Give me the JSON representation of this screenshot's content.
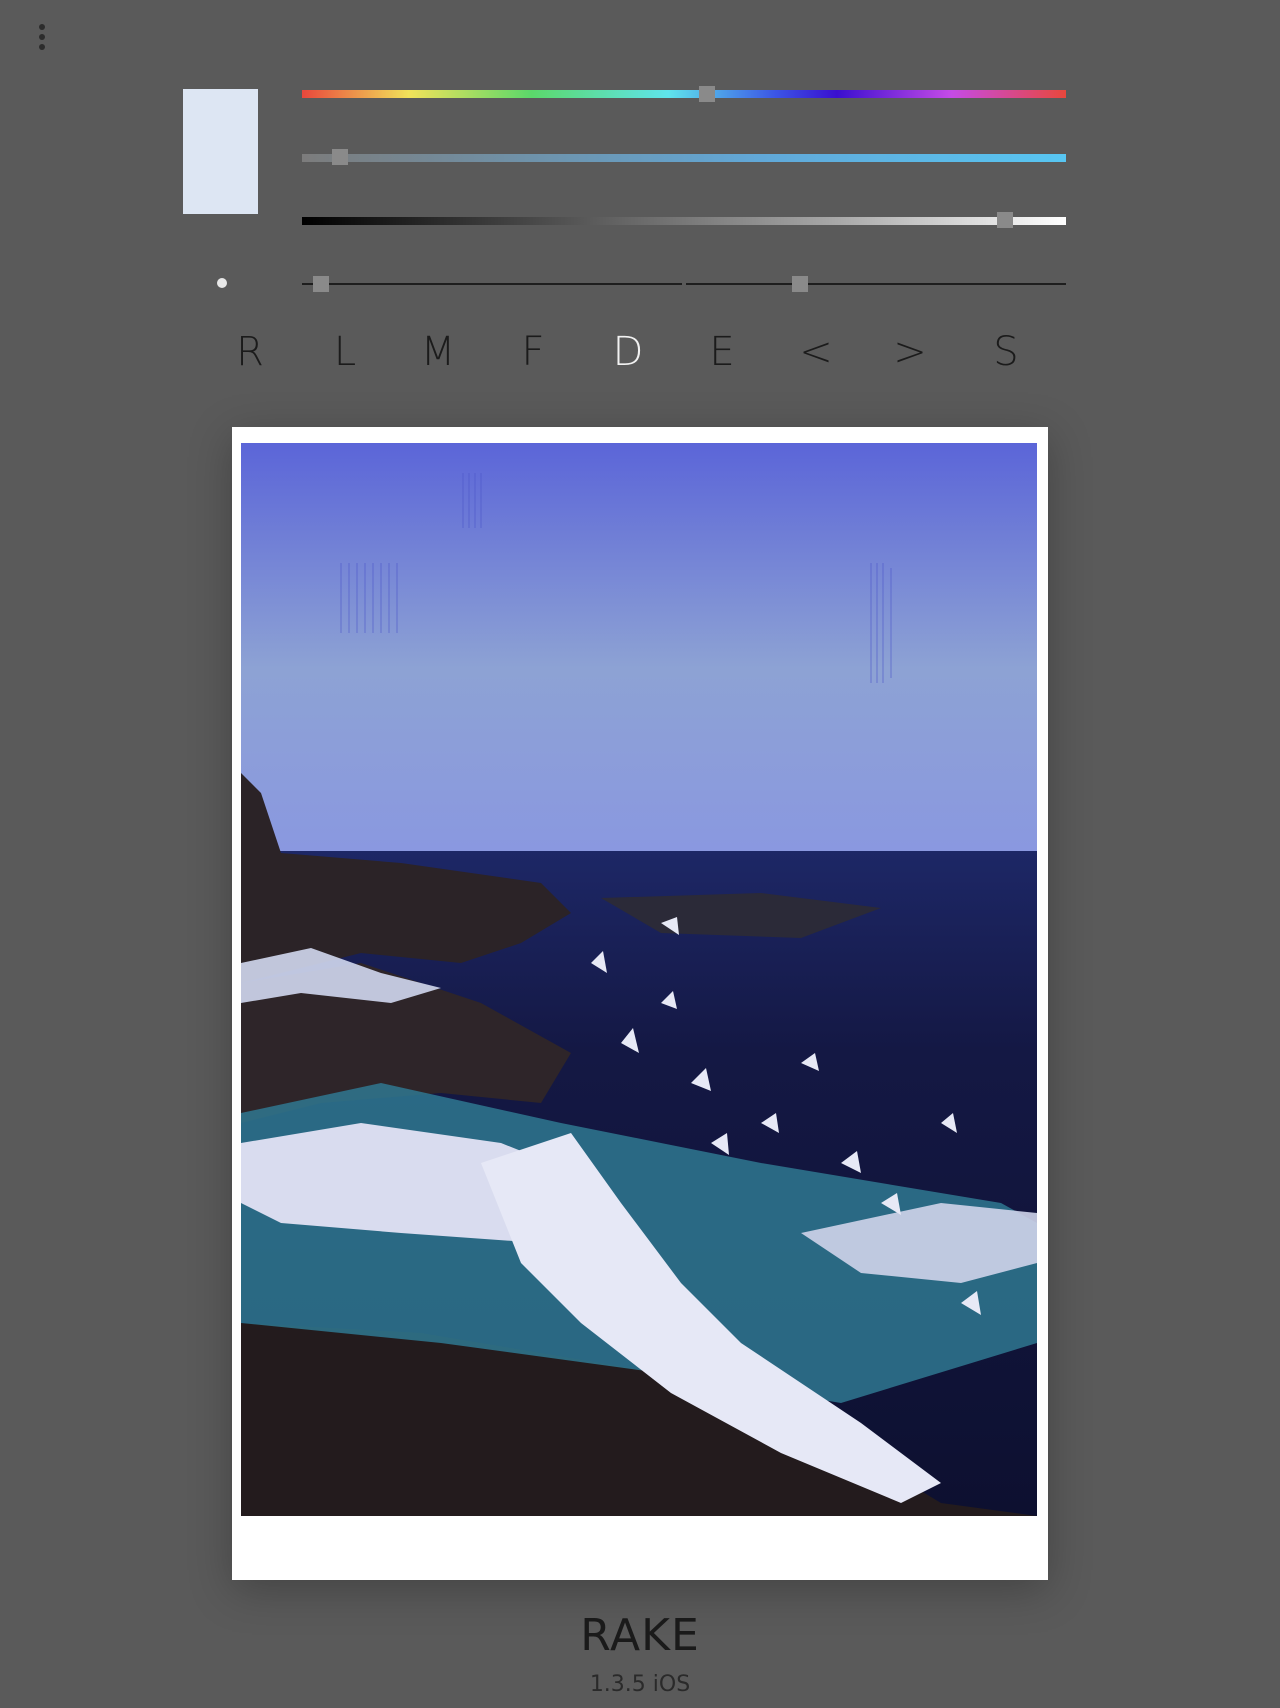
{
  "toolbar": {
    "tools": [
      "R",
      "L",
      "M",
      "F",
      "D",
      "E",
      "<",
      ">",
      "S"
    ],
    "active_tool": "D"
  },
  "color": {
    "current_swatch": "#dde6f3",
    "hue_level": 0.53,
    "saturation_level": 0.05,
    "value_level": 0.92
  },
  "brush": {
    "size_level": 0.05,
    "opacity_level": 0.3
  },
  "footer": {
    "app_name": "RAKE",
    "version": "1.3.5 iOS"
  }
}
